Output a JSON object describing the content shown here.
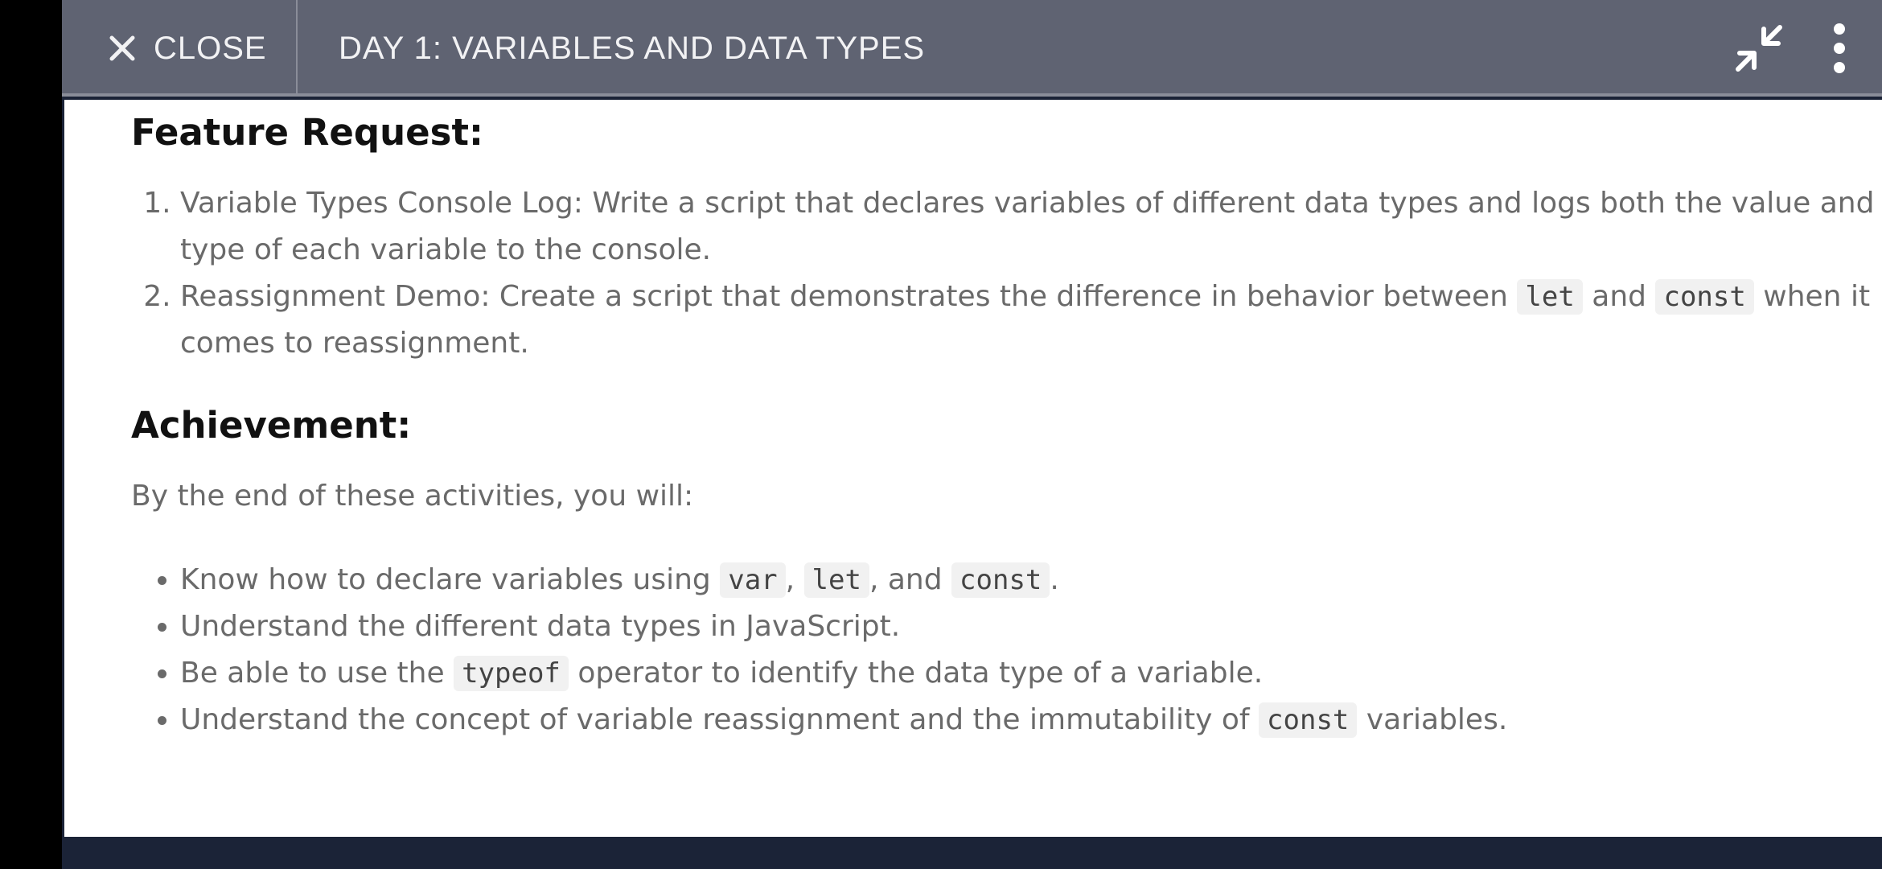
{
  "header": {
    "close_label": "CLOSE",
    "title": "DAY 1: VARIABLES AND DATA TYPES",
    "icons": [
      "close-icon",
      "collapse-icon",
      "more-vert-icon"
    ]
  },
  "content": {
    "feature_heading": "Feature Request:",
    "features": [
      {
        "pre": "Variable Types Console Log: Write a script that declares variables of different data types and logs both the value and type of each variable to the console."
      },
      {
        "pre": "Reassignment Demo: Create a script that demonstrates the difference in behavior between ",
        "code1": "let",
        "mid": " and ",
        "code2": "const",
        "post": " when it comes to reassignment."
      }
    ],
    "achievement_heading": "Achievement:",
    "intro": "By the end of these activities, you will:",
    "achievements": [
      {
        "pre": "Know how to declare variables using ",
        "code1": "var",
        "sep1": ", ",
        "code2": "let",
        "sep2": ", and ",
        "code3": "const",
        "post": "."
      },
      {
        "text": "Understand the different data types in JavaScript."
      },
      {
        "pre": "Be able to use the ",
        "code1": "typeof",
        "post": " operator to identify the data type of a variable."
      },
      {
        "pre": "Understand the concept of variable reassignment and the immutability of ",
        "code1": "const",
        "post": " variables."
      }
    ]
  },
  "colors": {
    "topbar": "#5f6372",
    "body_text": "#6a6a6a",
    "heading": "#111111",
    "code_bg": "#f1f1f1",
    "bottom": "#1b2337"
  }
}
